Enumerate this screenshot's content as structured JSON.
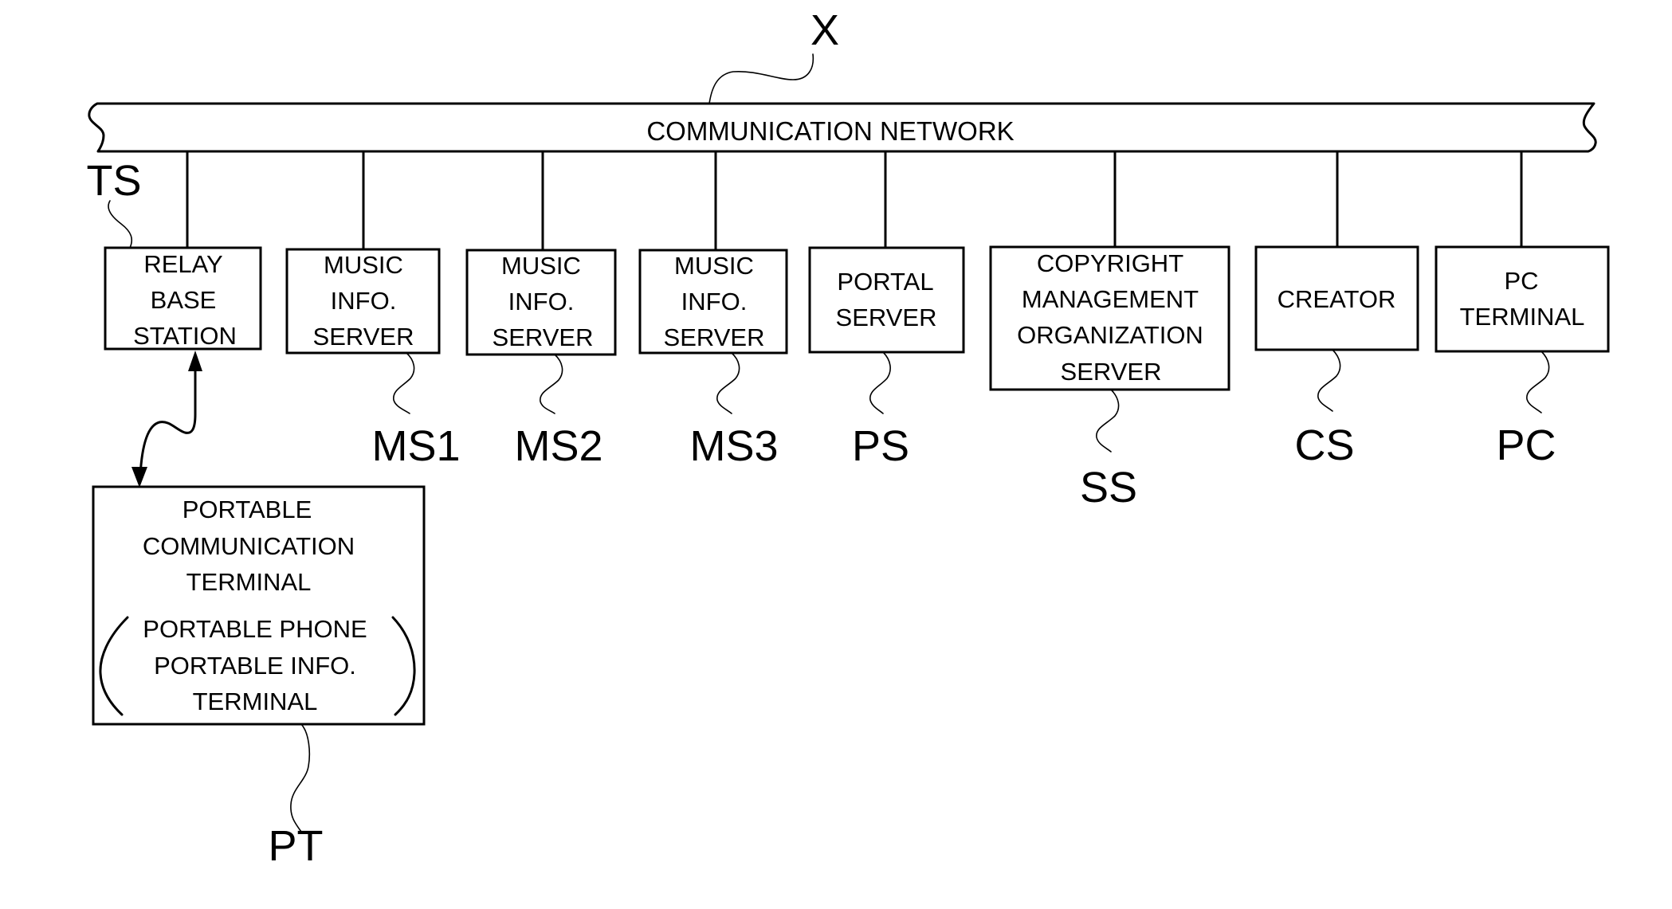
{
  "diagram": {
    "type": "network-block-diagram",
    "network": {
      "label": "COMMUNICATION NETWORK",
      "ref": "X"
    },
    "nodes": [
      {
        "id": "relay-base-station",
        "lines": [
          "RELAY",
          "BASE",
          "STATION"
        ],
        "ref": "TS"
      },
      {
        "id": "music-info-server-1",
        "lines": [
          "MUSIC",
          "INFO.",
          "SERVER"
        ],
        "ref": "MS1"
      },
      {
        "id": "music-info-server-2",
        "lines": [
          "MUSIC",
          "INFO.",
          "SERVER"
        ],
        "ref": "MS2"
      },
      {
        "id": "music-info-server-3",
        "lines": [
          "MUSIC",
          "INFO.",
          "SERVER"
        ],
        "ref": "MS3"
      },
      {
        "id": "portal-server",
        "lines": [
          "PORTAL",
          "SERVER"
        ],
        "ref": "PS"
      },
      {
        "id": "copyright-management-organization-server",
        "lines": [
          "COPYRIGHT",
          "MANAGEMENT",
          "ORGANIZATION",
          "SERVER"
        ],
        "ref": "SS"
      },
      {
        "id": "creator",
        "lines": [
          "CREATOR"
        ],
        "ref": "CS"
      },
      {
        "id": "pc-terminal",
        "lines": [
          "PC",
          "TERMINAL"
        ],
        "ref": "PC"
      }
    ],
    "terminal": {
      "id": "portable-communication-terminal",
      "lines": [
        "PORTABLE",
        "COMMUNICATION",
        "TERMINAL"
      ],
      "sub_lines": [
        "PORTABLE PHONE",
        "PORTABLE INFO.",
        "TERMINAL"
      ],
      "paren_open": "(",
      "paren_close": ")",
      "ref": "PT"
    },
    "links": [
      {
        "from": "relay-base-station",
        "to": "portable-communication-terminal",
        "type": "wireless-bidirectional"
      }
    ]
  }
}
